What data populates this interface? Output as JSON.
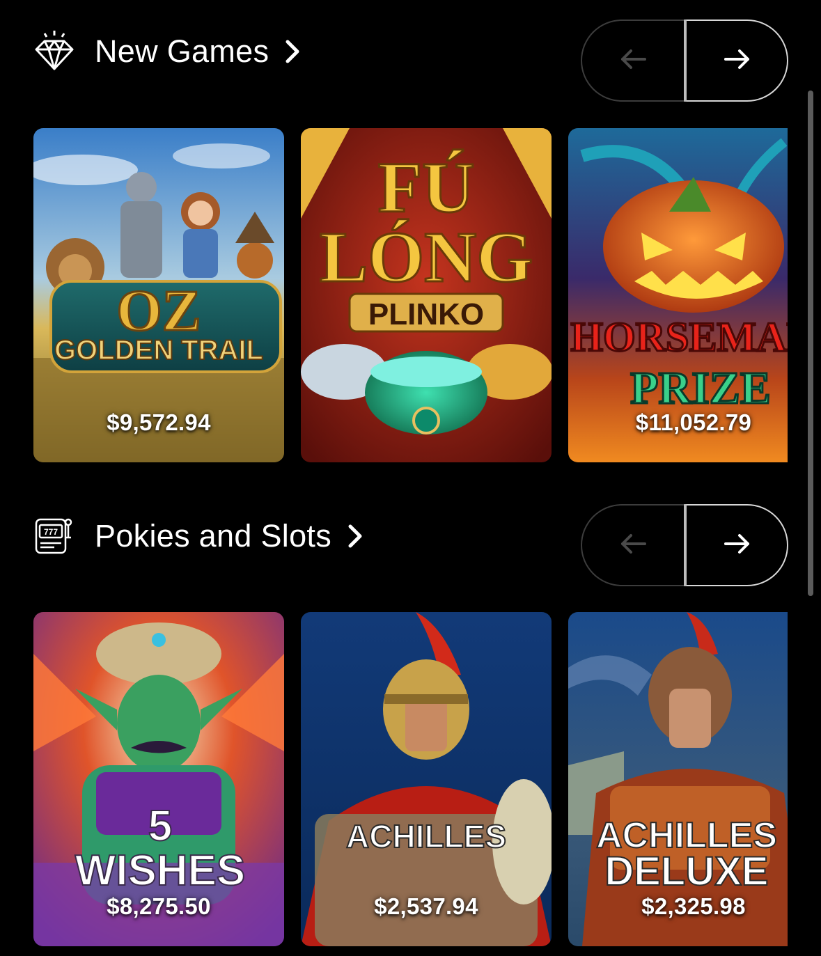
{
  "sections": [
    {
      "title": "New Games",
      "icon": "diamond-icon",
      "games": [
        {
          "title_line1": "OZ",
          "title_line2": "GOLDEN TRAIL",
          "jackpot": "$9,572.94"
        },
        {
          "title_line1": "FÚ",
          "title_line2": "LÓNG",
          "title_line3": "PLINKO",
          "jackpot": ""
        },
        {
          "title_line1": "HORSEMAN",
          "title_line2": "PRIZE",
          "jackpot": "$11,052.79"
        }
      ]
    },
    {
      "title": "Pokies and Slots",
      "icon": "slot-machine-icon",
      "icon_text": "777",
      "games": [
        {
          "title_line1": "5",
          "title_line2": "WISHES",
          "jackpot": "$8,275.50"
        },
        {
          "title_line1": "ACHILLES",
          "jackpot": "$2,537.94"
        },
        {
          "title_line1": "ACHILLES",
          "title_line2": "DELUXE",
          "jackpot": "$2,325.98"
        }
      ]
    }
  ],
  "colors": {
    "background": "#000000",
    "pager_border_active": "#d7d7d7",
    "pager_border_inactive": "#3c3c3c",
    "scrollbar": "#5b5b5b"
  }
}
